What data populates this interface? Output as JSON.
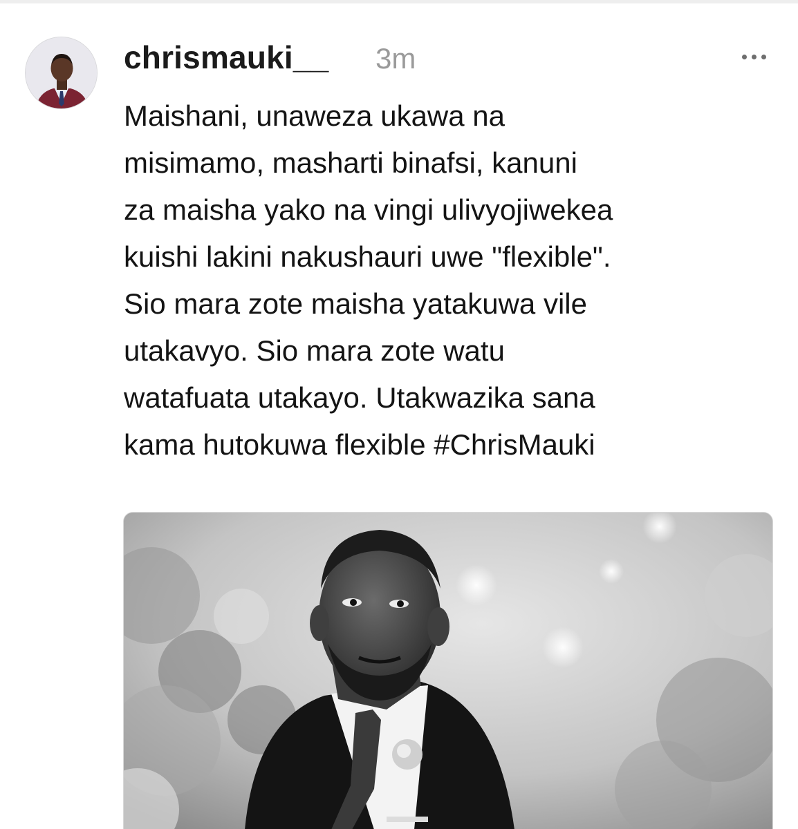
{
  "post": {
    "username": "chrismauki__",
    "timestamp": "3m",
    "more_icon": "more-horizontal-icon",
    "body_lines": [
      "Maishani, unaweza ukawa na",
      "misimamo, masharti binafsi, kanuni",
      "za maisha yako na vingi ulivyojiwekea",
      "kuishi lakini nakushauri uwe \"flexible\".",
      "Sio mara zote maisha yatakuwa vile",
      "utakavyo. Sio mara zote watu",
      "watafuata utakayo. Utakwazika sana",
      "kama hutokuwa flexible #ChrisMauki"
    ]
  },
  "colors": {
    "text": "#141414",
    "muted": "#9a9a9a",
    "icon": "#6e6e6e",
    "background": "#ffffff"
  }
}
